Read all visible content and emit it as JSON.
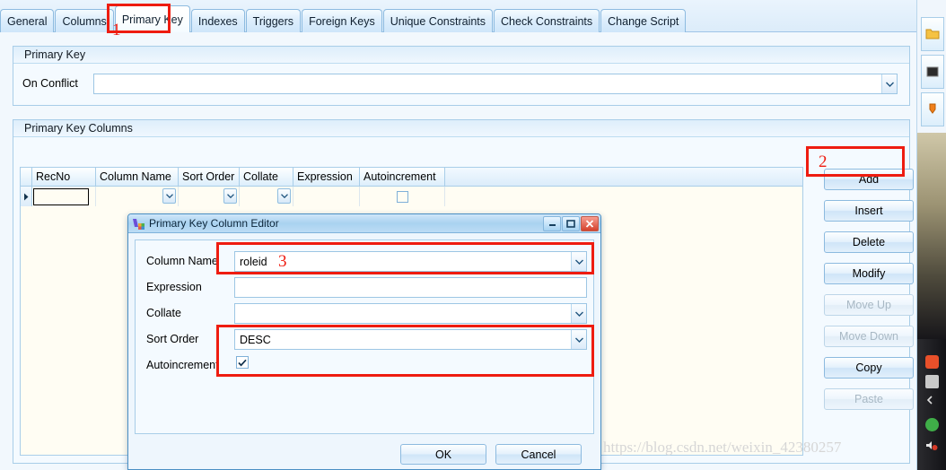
{
  "tabs": [
    {
      "label": "General",
      "active": false
    },
    {
      "label": "Columns",
      "active": false
    },
    {
      "label": "Primary Key",
      "active": true
    },
    {
      "label": "Indexes",
      "active": false
    },
    {
      "label": "Triggers",
      "active": false
    },
    {
      "label": "Foreign Keys",
      "active": false
    },
    {
      "label": "Unique Constraints",
      "active": false
    },
    {
      "label": "Check Constraints",
      "active": false
    },
    {
      "label": "Change Script",
      "active": false
    }
  ],
  "primary_key_group": {
    "title": "Primary Key",
    "on_conflict_label": "On Conflict",
    "on_conflict_value": "",
    "on_conflict_placeholder": ""
  },
  "columns_group": {
    "title": "Primary Key Columns",
    "grid": {
      "headers": [
        "RecNo",
        "Column Name",
        "Sort Order",
        "Collate",
        "Expression",
        "Autoincrement"
      ],
      "rows": [
        {
          "recno": "",
          "column_name": "",
          "sort_order": "",
          "collate": "",
          "expression": "",
          "autoincrement": false
        }
      ]
    },
    "buttons": [
      {
        "label": "Add",
        "enabled": true
      },
      {
        "label": "Insert",
        "enabled": true
      },
      {
        "label": "Delete",
        "enabled": true
      },
      {
        "label": "Modify",
        "enabled": true
      },
      {
        "label": "Move Up",
        "enabled": false
      },
      {
        "label": "Move Down",
        "enabled": false
      },
      {
        "label": "Copy",
        "enabled": true
      },
      {
        "label": "Paste",
        "enabled": false
      }
    ]
  },
  "dialog": {
    "title": "Primary Key Column Editor",
    "fields": {
      "column_name_label": "Column Name",
      "column_name_value": "roleid",
      "expression_label": "Expression",
      "expression_value": "",
      "collate_label": "Collate",
      "collate_value": "",
      "sort_order_label": "Sort Order",
      "sort_order_value": "DESC",
      "autoincrement_label": "Autoincrement",
      "autoincrement_checked": true
    },
    "ok_label": "OK",
    "cancel_label": "Cancel",
    "window_controls": {
      "minimize": "minimize-icon",
      "maximize": "maximize-icon",
      "close": "close-icon"
    }
  },
  "annotations": [
    {
      "number": "1"
    },
    {
      "number": "2"
    },
    {
      "number": "3"
    }
  ],
  "watermark": "https://blog.csdn.net/weixin_42380257",
  "colors": {
    "annotation_red": "#ee1c10",
    "panel_bg": "#f4faff",
    "grid_bg": "#fffdf3",
    "border_blue": "#a8cde8"
  }
}
